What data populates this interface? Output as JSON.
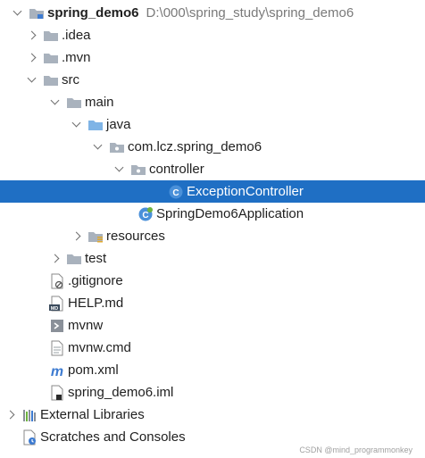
{
  "project": {
    "name": "spring_demo6",
    "path": "D:\\000\\spring_study\\spring_demo6"
  },
  "items": {
    "idea": ".idea",
    "mvn": ".mvn",
    "src": "src",
    "main": "main",
    "java": "java",
    "package": "com.lcz.spring_demo6",
    "controller": "controller",
    "exception_controller": "ExceptionController",
    "app": "SpringDemo6Application",
    "resources": "resources",
    "test": "test",
    "gitignore": ".gitignore",
    "help": "HELP.md",
    "mvnw": "mvnw",
    "mvnw_cmd": "mvnw.cmd",
    "pom": "pom.xml",
    "iml": "spring_demo6.iml",
    "external": "External Libraries",
    "scratches": "Scratches and Consoles"
  },
  "watermark": "CSDN @mind_programmonkey",
  "colors": {
    "selection": "#1f6fc4",
    "folder": "#a9b2bd",
    "source_folder": "#7fb4e6",
    "class_icon": "#4a90d9"
  }
}
